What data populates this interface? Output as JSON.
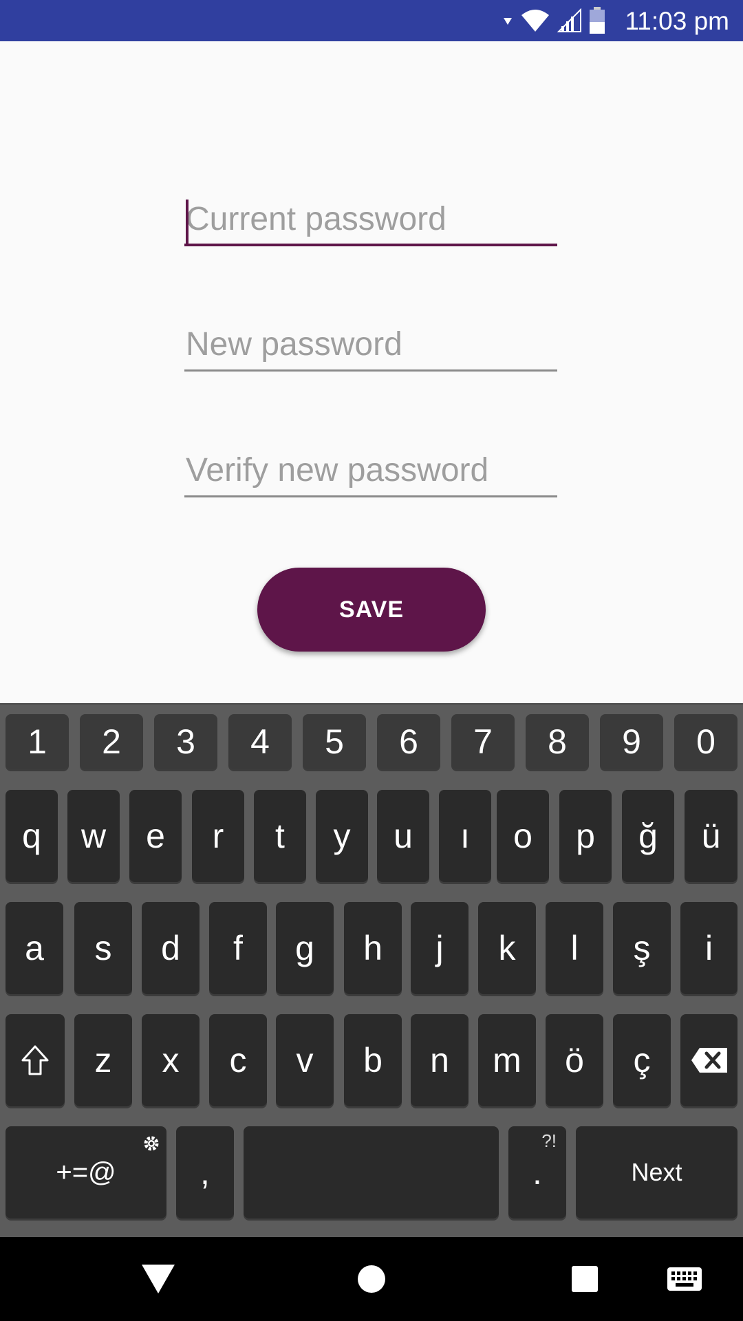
{
  "status_bar": {
    "time": "11:03 pm",
    "icons": [
      "download-arrow-icon",
      "wifi-icon",
      "signal-icon",
      "battery-icon"
    ],
    "background": "#303f9f"
  },
  "form": {
    "current_password": {
      "placeholder": "Current password",
      "value": ""
    },
    "new_password": {
      "placeholder": "New password",
      "value": ""
    },
    "verify_password": {
      "placeholder": "Verify new password",
      "value": ""
    },
    "save_label": "SAVE",
    "accent_color": "#5e1549"
  },
  "keyboard": {
    "number_row": [
      "1",
      "2",
      "3",
      "4",
      "5",
      "6",
      "7",
      "8",
      "9",
      "0"
    ],
    "row1": [
      "q",
      "w",
      "e",
      "r",
      "t",
      "y",
      "u",
      "ı",
      "o",
      "p",
      "ğ",
      "ü"
    ],
    "row2": [
      "a",
      "s",
      "d",
      "f",
      "g",
      "h",
      "j",
      "k",
      "l",
      "ş",
      "i"
    ],
    "row3": [
      "z",
      "x",
      "c",
      "v",
      "b",
      "n",
      "m",
      "ö",
      "ç"
    ],
    "symbols_label": "+=@",
    "comma_label": ",",
    "period_label": ".",
    "period_hint": "?!",
    "next_label": "Next"
  },
  "nav_bar": {
    "buttons": [
      "back-icon",
      "home-icon",
      "recents-icon",
      "keyboard-switch-icon"
    ]
  }
}
